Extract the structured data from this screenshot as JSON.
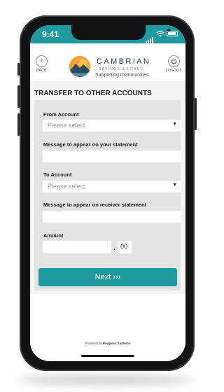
{
  "status_bar": {
    "time": "9:41"
  },
  "header": {
    "back_label": "BACK",
    "logout_label": "LOGOUT",
    "brand_name": "CAMBRIAN",
    "brand_subtitle": "SAVINGS & LOANS",
    "brand_tagline": "Supporting Communities"
  },
  "page_title": "TRANSFER TO OTHER ACCOUNTS",
  "form": {
    "from_account_label": "From Account",
    "from_account_placeholder": "Please select",
    "statement_message_label": "Message to appear on your statement",
    "statement_message_value": "",
    "to_account_label": "To Account",
    "to_account_placeholder": "Please select",
    "receiver_message_label": "Message to appear on receiver statement",
    "receiver_message_value": "",
    "amount_label": "Amount",
    "amount_decimal_separator": ".",
    "amount_cents": "00",
    "next_button_label": "Next ›››"
  },
  "footer": {
    "powered_by_prefix": "Powered by",
    "powered_by_company": "Progress Systems"
  },
  "colors": {
    "accent": "#1f9aa0",
    "logo_orange": "#f0a23a",
    "logo_navy": "#2d4a63",
    "form_background": "#e3e3e4"
  }
}
